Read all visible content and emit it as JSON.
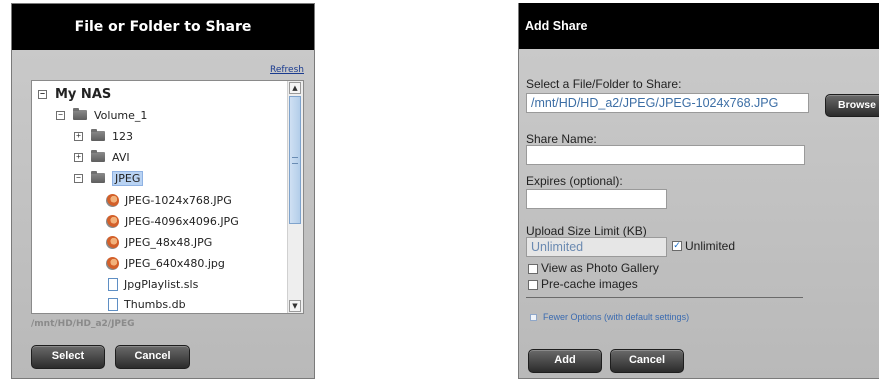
{
  "left_dialog": {
    "title": "File or Folder to Share",
    "refresh_label": "Refresh",
    "tree": {
      "root": "My NAS",
      "volume": "Volume_1",
      "folders": [
        "123",
        "AVI",
        "JPEG"
      ],
      "selected_folder": "JPEG",
      "files": [
        "JPEG-1024x768.JPG",
        "JPEG-4096x4096.JPG",
        "JPEG_48x48.JPG",
        "JPEG_640x480.jpg",
        "JpgPlaylist.sls",
        "Thumbs.db"
      ]
    },
    "current_path": "/mnt/HD/HD_a2/JPEG",
    "select_label": "Select",
    "cancel_label": "Cancel"
  },
  "right_dialog": {
    "title": "Add Share",
    "select_label": "Select a File/Folder to Share:",
    "path_value": "/mnt/HD/HD_a2/JPEG/JPEG-1024x768.JPG",
    "browse_label": "Browse",
    "share_name_label": "Share Name:",
    "share_name_value": "",
    "expires_label": "Expires (optional):",
    "expires_value": "",
    "upload_limit_label": "Upload Size Limit (KB)",
    "upload_limit_value": "Unlimited",
    "unlimited_label": "Unlimited",
    "unlimited_checked": true,
    "photo_gallery_label": "View as Photo Gallery",
    "precache_label": "Pre-cache images",
    "fewer_options_label": "Fewer Options (with default settings)",
    "add_label": "Add",
    "cancel_label": "Cancel"
  }
}
